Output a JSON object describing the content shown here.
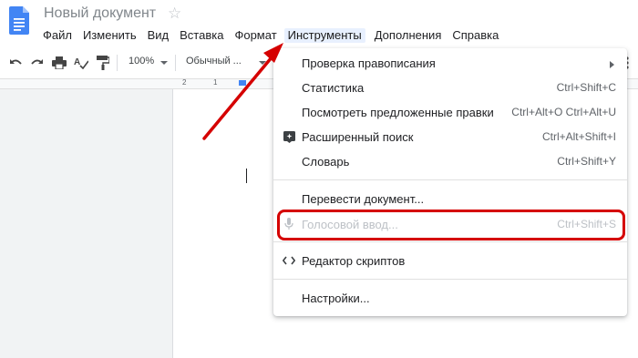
{
  "app": {
    "title": "Новый документ"
  },
  "menubar": {
    "items": [
      "Файл",
      "Изменить",
      "Вид",
      "Вставка",
      "Формат",
      "Инструменты",
      "Дополнения",
      "Справка"
    ]
  },
  "toolbar": {
    "zoom": "100%",
    "style": "Обычный ..."
  },
  "ruler": {
    "marks": [
      "2",
      "1"
    ]
  },
  "dropdown": {
    "items": [
      {
        "label": "Проверка правописания",
        "shortcut": ""
      },
      {
        "label": "Статистика",
        "shortcut": "Ctrl+Shift+C"
      },
      {
        "label": "Посмотреть предложенные правки",
        "shortcut": "Ctrl+Alt+O Ctrl+Alt+U"
      },
      {
        "label": "Расширенный поиск",
        "shortcut": "Ctrl+Alt+Shift+I"
      },
      {
        "label": "Словарь",
        "shortcut": "Ctrl+Shift+Y"
      },
      {
        "label": "Перевести документ...",
        "shortcut": ""
      },
      {
        "label": "Голосовой ввод...",
        "shortcut": "Ctrl+Shift+S"
      },
      {
        "label": "Редактор скриптов",
        "shortcut": ""
      },
      {
        "label": "Настройки...",
        "shortcut": ""
      }
    ]
  },
  "colors": {
    "accent": "#4285f4",
    "annotation": "#d50000",
    "active_menu_bg": "#e8f0fe"
  }
}
